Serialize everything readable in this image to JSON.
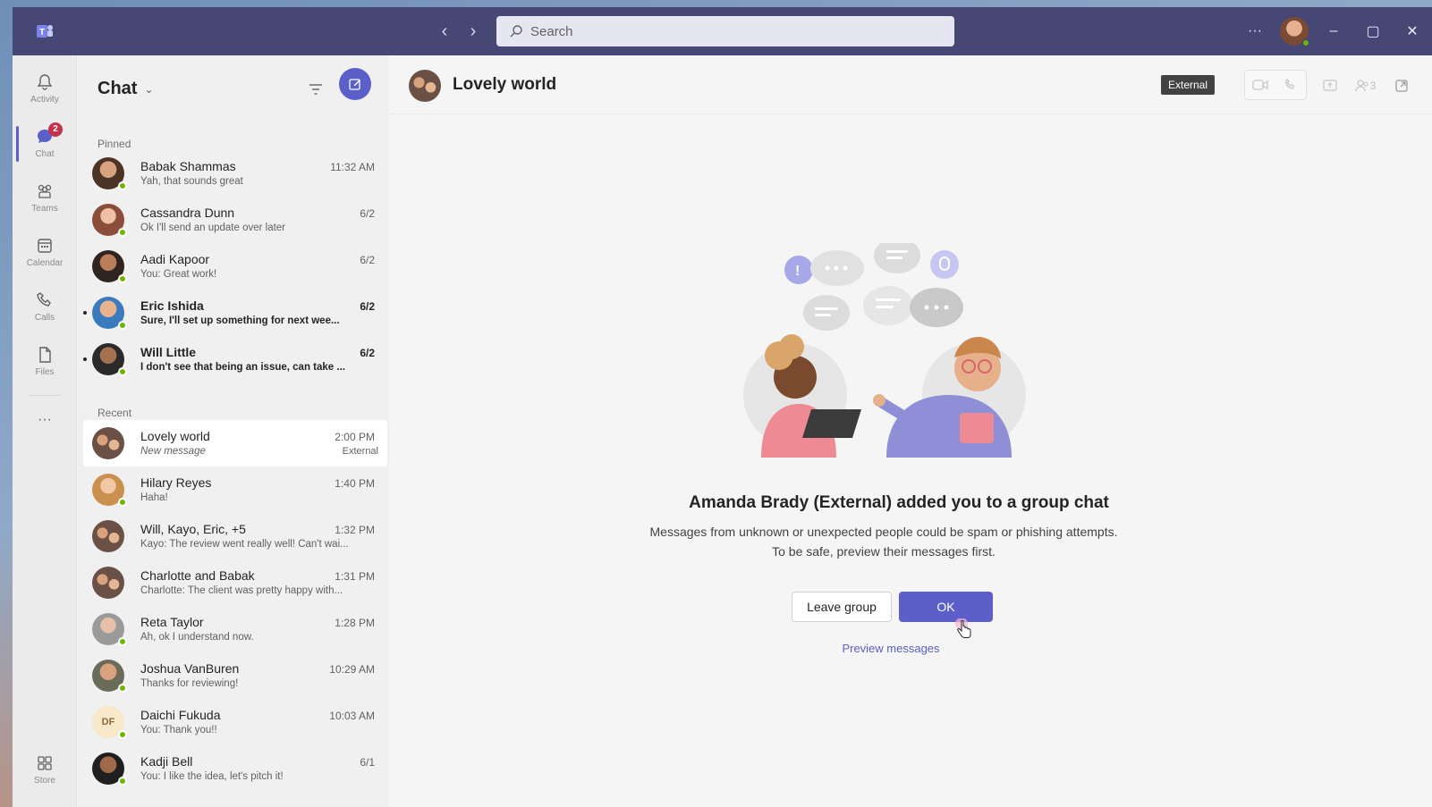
{
  "titlebar": {
    "search_placeholder": "Search",
    "more_label": "···"
  },
  "rail": {
    "items": [
      {
        "label": "Activity",
        "icon": "bell-icon"
      },
      {
        "label": "Chat",
        "icon": "chat-icon",
        "badge": "2"
      },
      {
        "label": "Teams",
        "icon": "teams-icon"
      },
      {
        "label": "Calendar",
        "icon": "calendar-icon"
      },
      {
        "label": "Calls",
        "icon": "phone-icon"
      },
      {
        "label": "Files",
        "icon": "file-icon"
      }
    ],
    "more": "···",
    "store": "Store"
  },
  "chatlist": {
    "title": "Chat",
    "pinned_label": "Pinned",
    "recent_label": "Recent",
    "pinned": [
      {
        "name": "Babak Shammas",
        "preview": "Yah, that sounds great",
        "time": "11:32 AM"
      },
      {
        "name": "Cassandra Dunn",
        "preview": "Ok I'll send an update over later",
        "time": "6/2"
      },
      {
        "name": "Aadi Kapoor",
        "preview": "You: Great work!",
        "time": "6/2"
      },
      {
        "name": "Eric Ishida",
        "preview": "Sure, I'll set up something for next wee...",
        "time": "6/2"
      },
      {
        "name": "Will Little",
        "preview": "I don't see that being an issue, can take ...",
        "time": "6/2"
      }
    ],
    "recent": [
      {
        "name": "Lovely world",
        "preview": "New message",
        "time": "2:00 PM",
        "tag": "External"
      },
      {
        "name": "Hilary Reyes",
        "preview": "Haha!",
        "time": "1:40 PM"
      },
      {
        "name": "Will, Kayo, Eric, +5",
        "preview": "Kayo: The review went really well! Can't wai...",
        "time": "1:32 PM"
      },
      {
        "name": "Charlotte and Babak",
        "preview": "Charlotte: The client was pretty happy with...",
        "time": "1:31 PM"
      },
      {
        "name": "Reta Taylor",
        "preview": "Ah, ok I understand now.",
        "time": "1:28 PM"
      },
      {
        "name": "Joshua VanBuren",
        "preview": "Thanks for reviewing!",
        "time": "10:29 AM"
      },
      {
        "name": "Daichi Fukuda",
        "preview": "You: Thank you!!",
        "time": "10:03 AM",
        "initials": "DF"
      },
      {
        "name": "Kadji Bell",
        "preview": "You: I like the idea, let's pitch it!",
        "time": "6/1"
      }
    ]
  },
  "main": {
    "title": "Lovely world",
    "external_badge": "External",
    "participants_count": "3",
    "notice_title": "Amanda Brady (External) added you to a group chat",
    "notice_body": "Messages from unknown or unexpected people could be spam or phishing attempts. To be safe, preview their messages first.",
    "leave_label": "Leave group",
    "ok_label": "OK",
    "preview_link": "Preview messages"
  },
  "colors": {
    "brand": "#5b5fc7",
    "titlebar": "#464775",
    "presence": "#6bb700",
    "badge": "#c4314b"
  }
}
